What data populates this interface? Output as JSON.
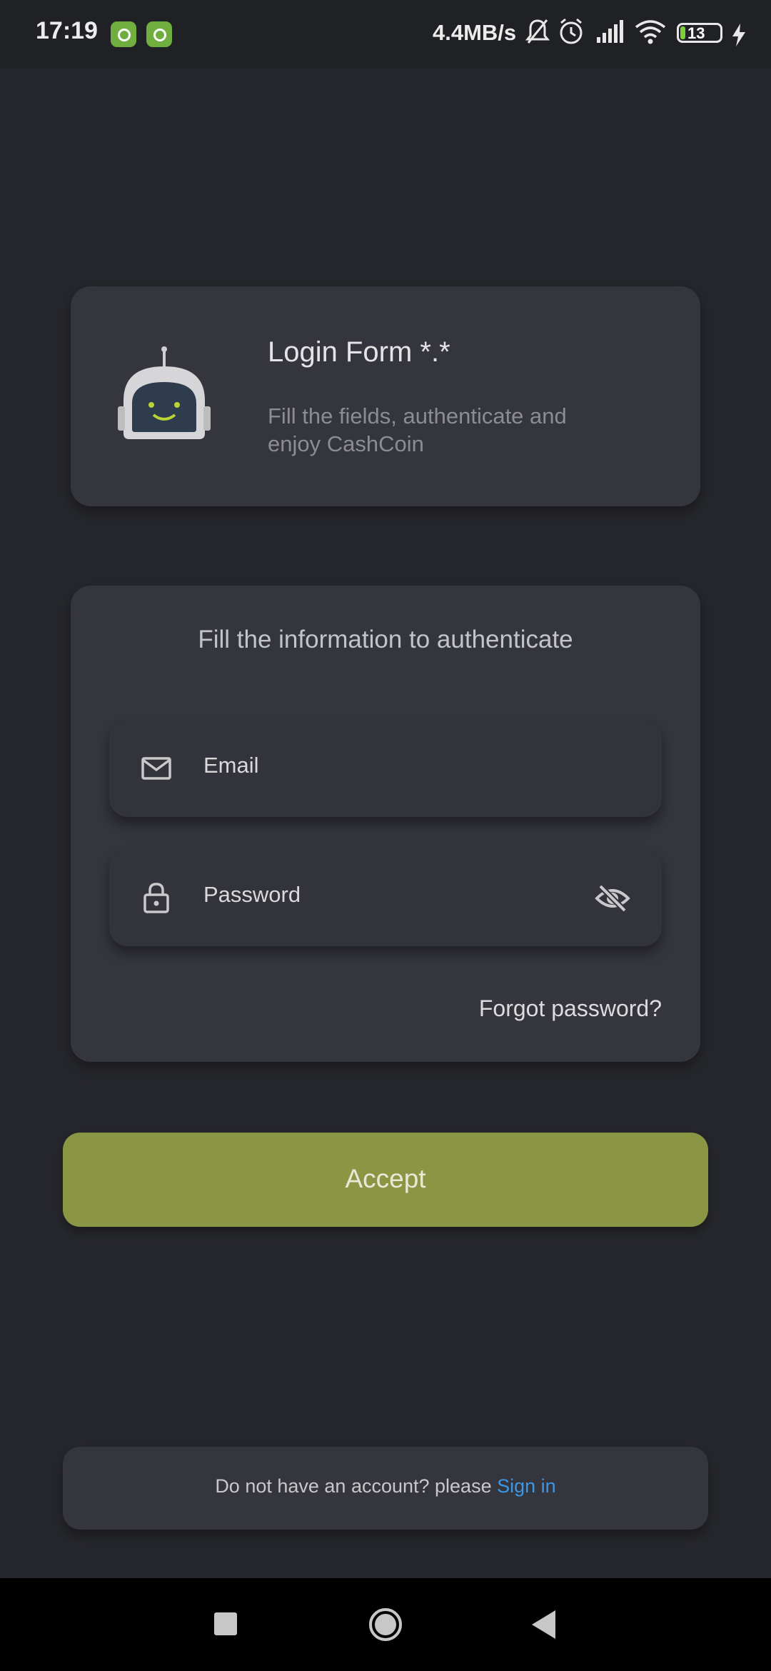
{
  "status_bar": {
    "time": "17:19",
    "network_speed": "4.4MB/s",
    "battery_level": "13",
    "battery_percent": 13,
    "icons": [
      "app-notification-icon",
      "app-notification-icon",
      "mute-icon",
      "alarm-icon",
      "signal-icon",
      "wifi-icon",
      "battery-icon",
      "charging-icon"
    ]
  },
  "header": {
    "title": "Login Form *.*",
    "subtitle": "Fill the fields, authenticate and enjoy CashCoin"
  },
  "form": {
    "heading": "Fill the information to authenticate",
    "email_placeholder": "Email",
    "password_placeholder": "Password",
    "forgot_label": "Forgot password?"
  },
  "accept_label": "Accept",
  "signup": {
    "prompt": "Do not have an account? please ",
    "link": "Sign in"
  },
  "colors": {
    "background": "#26272c",
    "card": "#34353d",
    "accent": "#8b9645",
    "link": "#3d97e6"
  }
}
